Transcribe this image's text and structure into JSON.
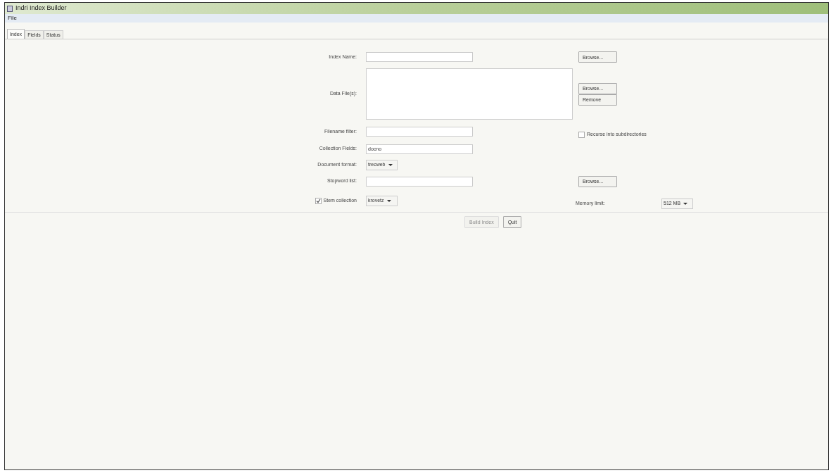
{
  "window": {
    "title": "Indri Index Builder"
  },
  "menu": [
    "File"
  ],
  "tabs": [
    {
      "label": "Index",
      "selected": true
    },
    {
      "label": "Fields",
      "selected": false
    },
    {
      "label": "Status",
      "selected": false
    }
  ],
  "form": {
    "rows": [
      {
        "kind": "text",
        "label": "Index Name:",
        "buttons": [
          "Browse..."
        ]
      },
      {
        "kind": "list",
        "label": "Data File(s):",
        "buttons": [
          "Browse...",
          "Remove"
        ]
      },
      {
        "kind": "text",
        "label": "Filename filter:",
        "checkbox": {
          "label": "Recurse into subdirectories",
          "checked": false
        }
      },
      {
        "kind": "text",
        "label": "Collection Fields:",
        "value": "docno"
      },
      {
        "kind": "dropdown",
        "label": "Document format:",
        "value": "trecweb"
      },
      {
        "kind": "text",
        "label": "Stopword list:",
        "buttons": [
          "Browse..."
        ]
      },
      {
        "kind": "dropdown",
        "label_checkbox": {
          "label": "Stem collection",
          "checked": true
        },
        "value": "krovetz",
        "side": {
          "label": "Memory limit:",
          "value": "512 MB"
        }
      }
    ]
  },
  "actions": [
    {
      "label": "Build Index",
      "disabled": true
    },
    {
      "label": "Quit",
      "disabled": false
    }
  ]
}
